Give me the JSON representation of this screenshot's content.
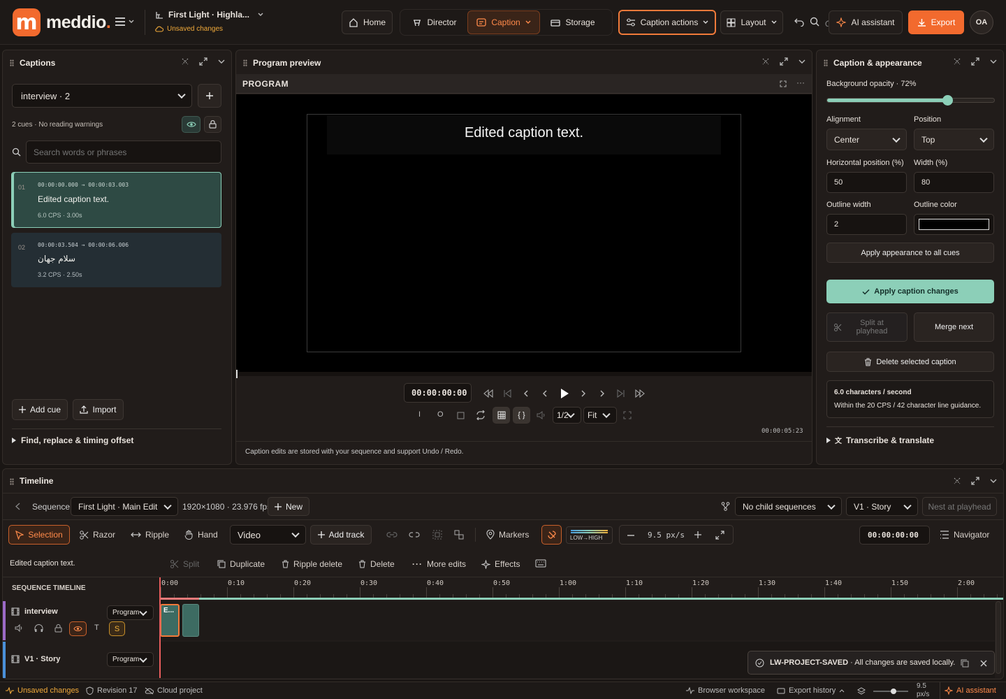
{
  "app": {
    "brand": "meddio",
    "project_title": "First Light · Highla...",
    "unsaved": "Unsaved changes"
  },
  "topnav": {
    "home": "Home",
    "director": "Director",
    "caption": "Caption",
    "storage": "Storage",
    "caption_actions": "Caption actions",
    "layout": "Layout",
    "ai": "AI assistant",
    "export": "Export",
    "avatar": "OA"
  },
  "captions_panel": {
    "title": "Captions",
    "track_select": "interview · 2",
    "status": "2 cues · No reading warnings",
    "search_placeholder": "Search words or phrases",
    "cues": [
      {
        "num": "01",
        "time": "00:00:00.000 → 00:00:03.003",
        "text": "Edited caption text.",
        "meta": "6.0 CPS · 3.00s"
      },
      {
        "num": "02",
        "time": "00:00:03.504 → 00:00:06.006",
        "text": "سلام جهان",
        "meta": "3.2 CPS · 2.50s"
      }
    ],
    "add_cue": "Add cue",
    "import": "Import",
    "find_replace": "Find, replace & timing offset"
  },
  "preview": {
    "title": "Program preview",
    "program": "PROGRAM",
    "caption_text": "Edited caption text.",
    "timecode": "00:00:00:00",
    "zoom_ratio": "1/2",
    "fit": "Fit",
    "duration": "00:00:05:23",
    "mark_in": "I",
    "mark_out": "O",
    "footer_note": "Caption edits are stored with your sequence and support Undo / Redo."
  },
  "appearance": {
    "title": "Caption & appearance",
    "bg_opacity_label": "Background opacity · 72%",
    "bg_opacity_value": 0.72,
    "alignment_label": "Alignment",
    "alignment": "Center",
    "position_label": "Position",
    "position": "Top",
    "hpos_label": "Horizontal position (%)",
    "hpos": "50",
    "width_label": "Width (%)",
    "width": "80",
    "outline_width_label": "Outline width",
    "outline_width": "2",
    "outline_color_label": "Outline color",
    "outline_color": "#000000",
    "apply_all": "Apply appearance to all cues",
    "apply_changes": "Apply caption changes",
    "split": "Split at playhead",
    "merge": "Merge next",
    "delete": "Delete selected caption",
    "cps_title": "6.0 characters / second",
    "cps_note": "Within the 20 CPS / 42 character line guidance.",
    "transcribe": "Transcribe & translate"
  },
  "timeline": {
    "title": "Timeline",
    "sequence_label": "Sequence",
    "sequence": "First Light · Main Edit",
    "format": "1920×1080 · 23.976 fps",
    "new": "New",
    "child_seq": "No child sequences",
    "track_target": "V1 · Story",
    "nest": "Nest at playhead",
    "tools": {
      "selection": "Selection",
      "razor": "Razor",
      "ripple": "Ripple",
      "hand": "Hand"
    },
    "track_type": "Video",
    "add_track": "Add track",
    "markers": "Markers",
    "levels": "LOW→HIGH",
    "zoom": "9.5 px/s",
    "timecode": "00:00:00:00",
    "navigator": "Navigator",
    "selected_clip": "Edited caption text.",
    "edit_actions": {
      "split": "Split",
      "duplicate": "Duplicate",
      "ripple_delete": "Ripple delete",
      "delete": "Delete",
      "more": "More edits",
      "effects": "Effects"
    },
    "seq_header": "SEQUENCE TIMELINE",
    "ticks": [
      "0:00",
      "0:10",
      "0:20",
      "0:30",
      "0:40",
      "0:50",
      "1:00",
      "1:10",
      "1:20",
      "1:30",
      "1:40",
      "1:50",
      "2:00"
    ],
    "tracks": [
      {
        "name": "interview",
        "target": "Program",
        "t": "T",
        "s": "S"
      },
      {
        "name": "V1 · Story",
        "target": "Program"
      }
    ],
    "clip_label": "E..."
  },
  "toast": {
    "code": "LW-PROJECT-SAVED",
    "message": " · All changes are saved locally."
  },
  "statusbar": {
    "unsaved": "Unsaved changes",
    "revision": "Revision 17",
    "cloud": "Cloud project",
    "workspace": "Browser workspace",
    "export_history": "Export history",
    "zoom": "9.5 px/s",
    "ai": "AI assistant"
  },
  "colors": {
    "accent": "#f26a2e",
    "teal": "#8ccfb8"
  }
}
